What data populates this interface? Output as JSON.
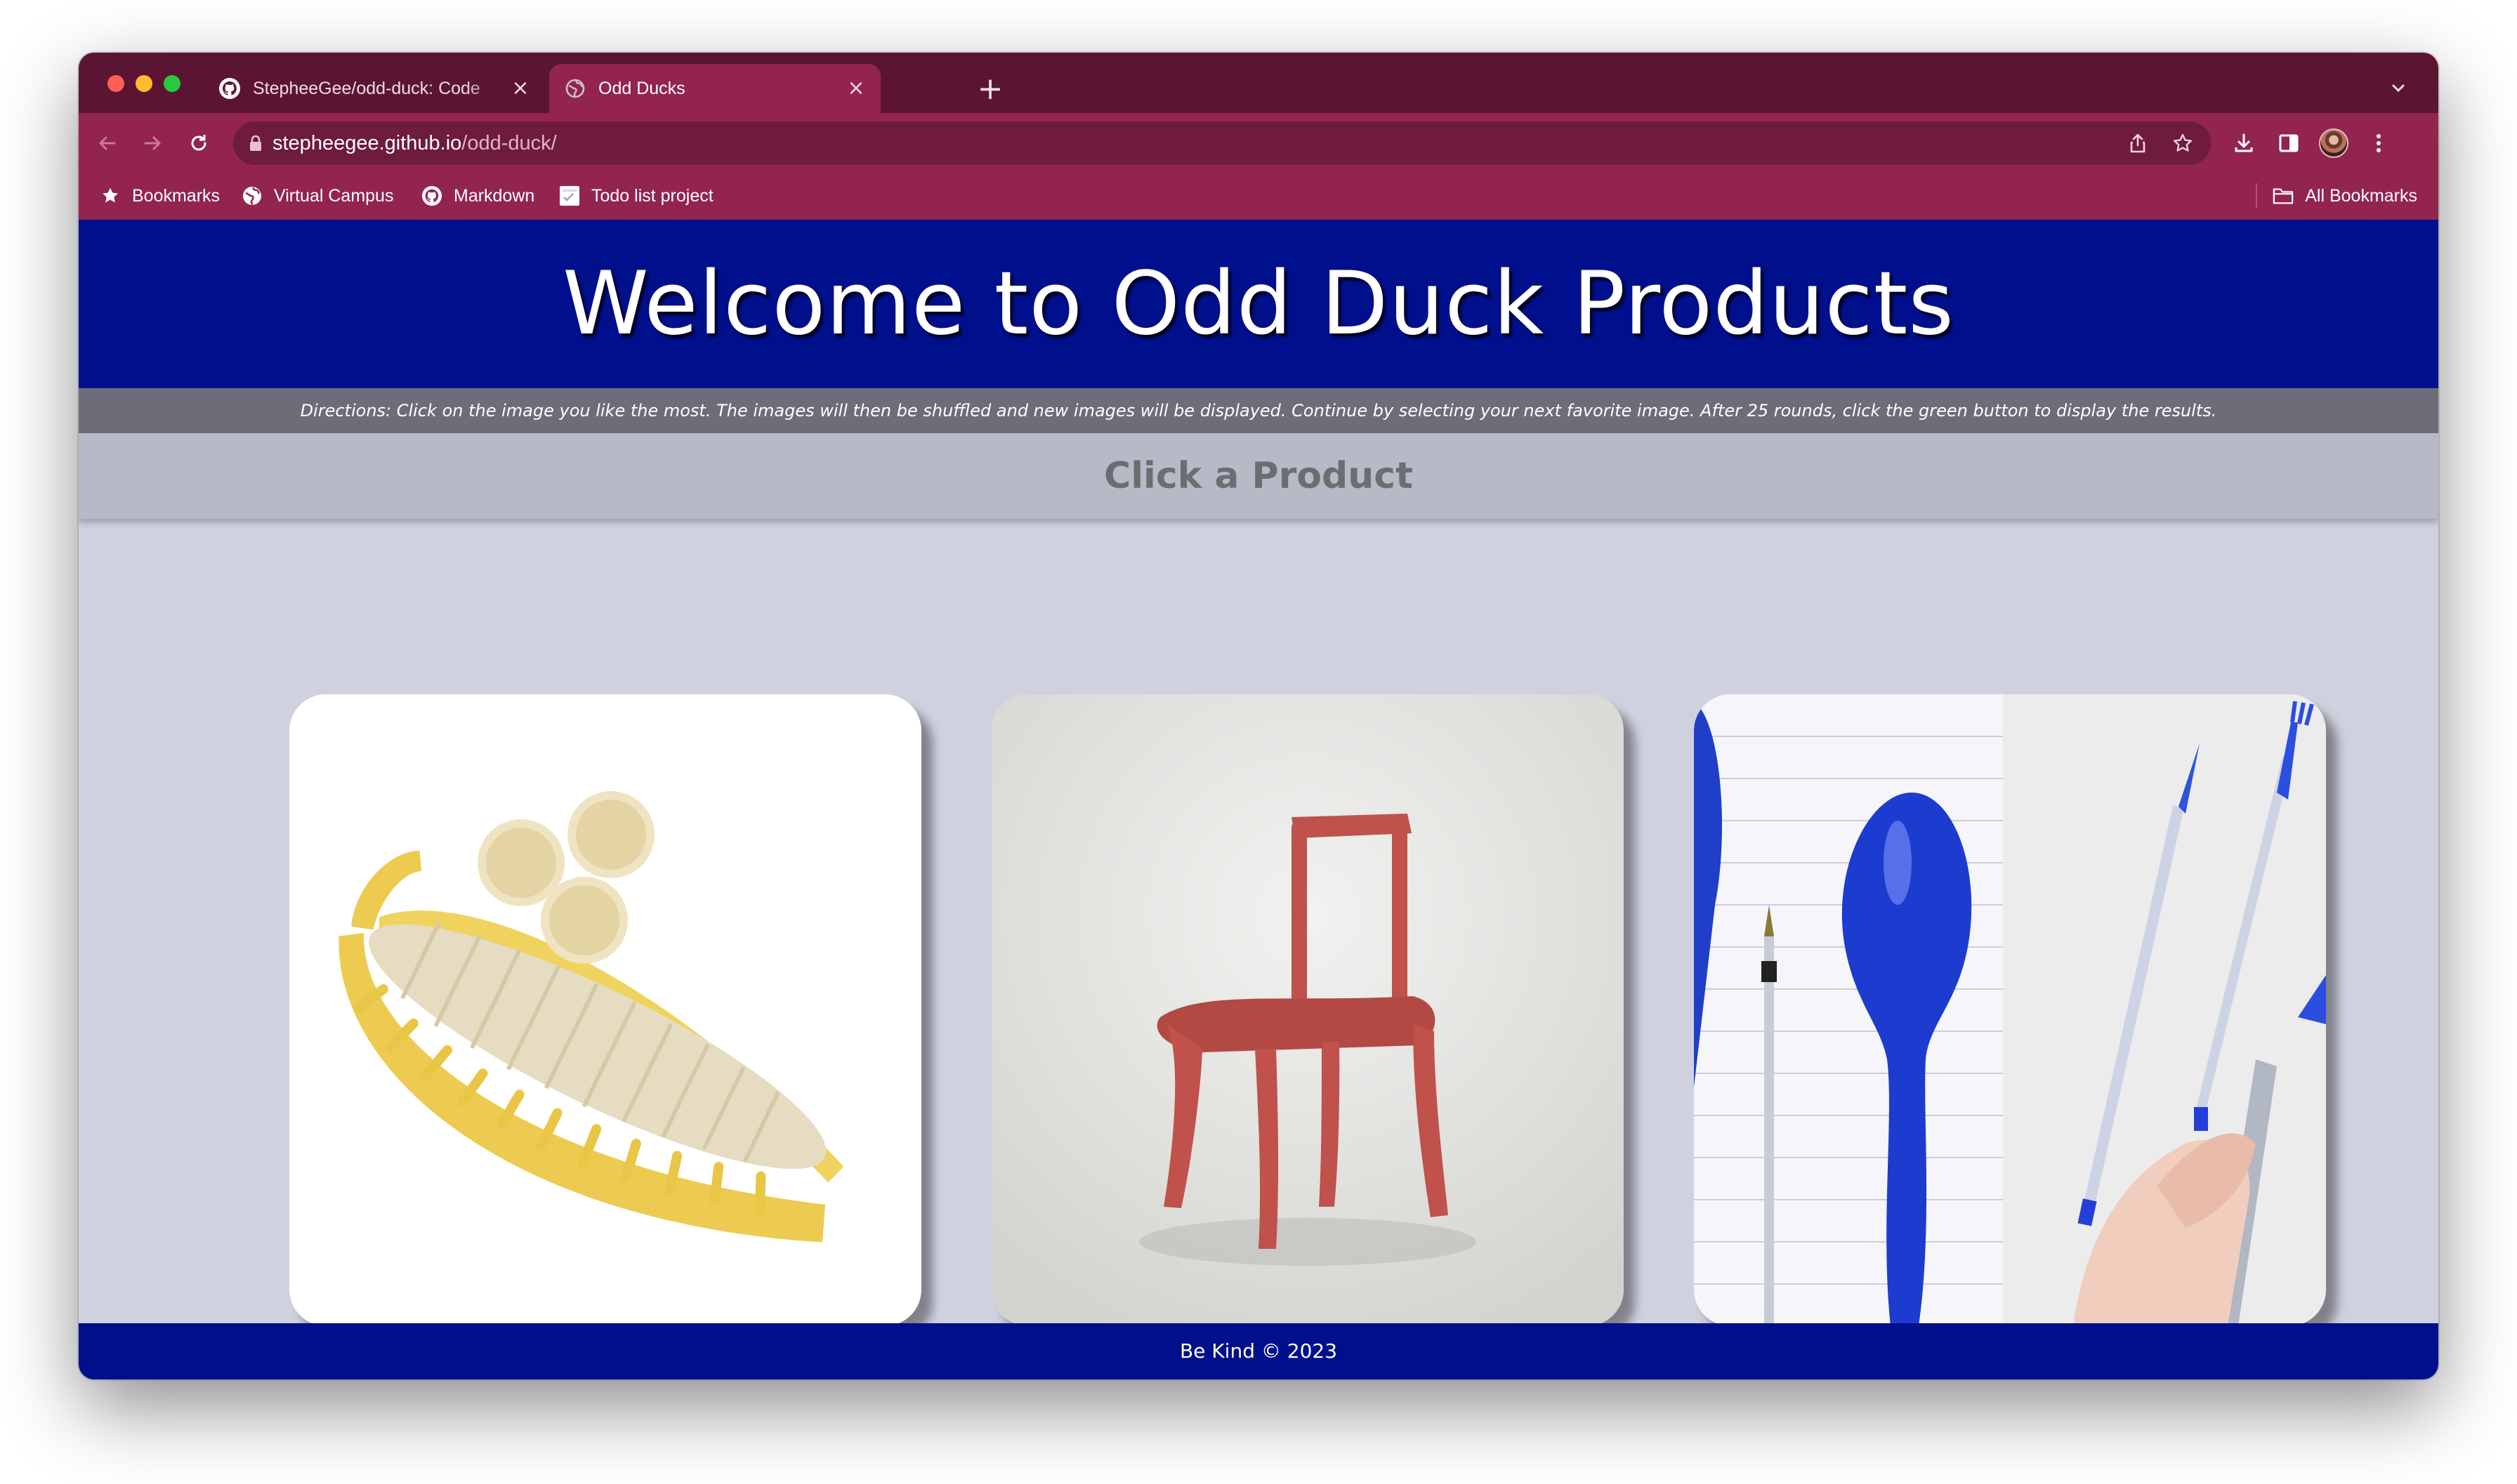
{
  "browser": {
    "tabs": [
      {
        "title": "StepheeGee/odd-duck: Code",
        "icon": "github-icon",
        "active": false
      },
      {
        "title": "Odd Ducks",
        "icon": "globe-icon",
        "active": true
      }
    ],
    "url": {
      "host": "stepheegee.github.io",
      "path": "/odd-duck/"
    },
    "bookmarks": [
      {
        "label": "Bookmarks",
        "icon": "star-icon"
      },
      {
        "label": "Virtual Campus",
        "icon": "globe-icon"
      },
      {
        "label": "Markdown",
        "icon": "github-icon"
      },
      {
        "label": "Todo list project",
        "icon": "page-icon"
      }
    ],
    "all_bookmarks": "All Bookmarks",
    "colors": {
      "frame": "#5b1532",
      "toolbar": "#93244e",
      "omnibox": "#6e1b3d"
    }
  },
  "page": {
    "title": "Welcome to Odd Duck Products",
    "directions": "Directions: Click on the image you like the most. The images will then be shuffled and new images will be displayed. Continue by selecting your next favorite image. After 25 rounds, click the green button to display the results.",
    "section_title": "Click a Product",
    "products": [
      {
        "name": "banana-slicer"
      },
      {
        "name": "chair"
      },
      {
        "name": "utensil-pen"
      }
    ],
    "footer": "Be Kind © 2023",
    "colors": {
      "header": "#000f8c",
      "directions_bar": "#6d6d79",
      "section_bar": "#b7b9c6",
      "background": "#cfd1df"
    }
  }
}
